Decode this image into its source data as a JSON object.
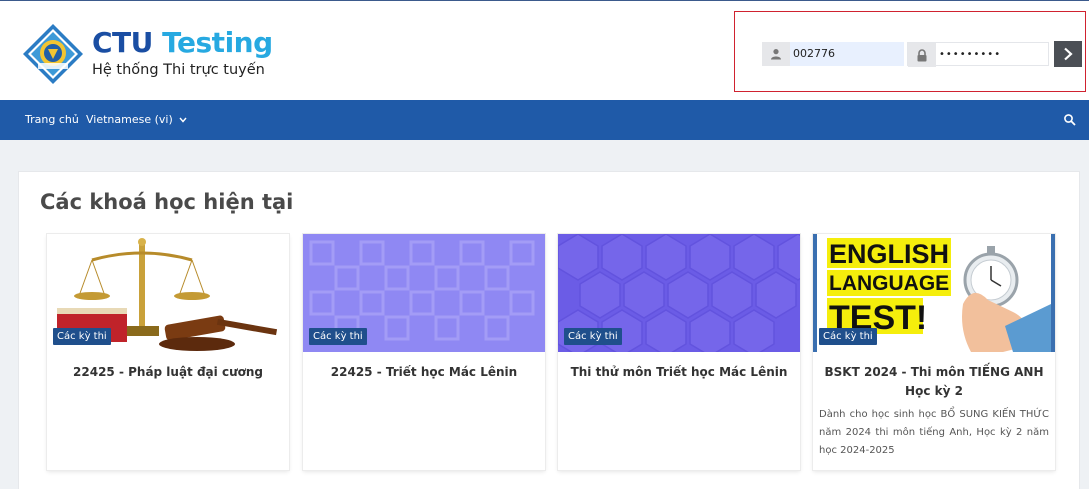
{
  "header": {
    "brand_part1": "CTU",
    "brand_part2": "Testing",
    "tagline": "Hệ thống Thi trực tuyến"
  },
  "login": {
    "username_value": "002776",
    "password_value": "•••••••••",
    "submit_icon": "chevron-right-icon"
  },
  "nav": {
    "home_label": "Trang chủ",
    "language_label": "Vietnamese (vi)",
    "search_icon": "search-icon"
  },
  "main": {
    "section_title": "Các khoá học hiện tại",
    "courses": [
      {
        "badge": "Các kỳ thi",
        "title": "22425 - Pháp luật đại cương",
        "description": ""
      },
      {
        "badge": "Các kỳ thi",
        "title": "22425 - Triết học Mác Lênin",
        "description": ""
      },
      {
        "badge": "Các kỳ thi",
        "title": "Thi thử môn Triết học Mác Lênin",
        "description": ""
      },
      {
        "badge": "Các kỳ thi",
        "title": "BSKT 2024 - Thi môn TIẾNG ANH Học kỳ 2",
        "description": "Dành cho học sinh học BỔ SUNG KIẾN THỨC năm 2024 thi môn tiếng Anh, Học kỳ 2 năm học 2024-2025"
      }
    ],
    "english_image_text": [
      "ENGLISH",
      "LANGUAGE",
      "TEST!"
    ]
  },
  "colors": {
    "navbar": "#1f5aa8",
    "brand_dark": "#1a4ea3",
    "brand_light": "#27a9e1",
    "badge": "#1f4f8c",
    "highlight_border": "#d0222f"
  }
}
